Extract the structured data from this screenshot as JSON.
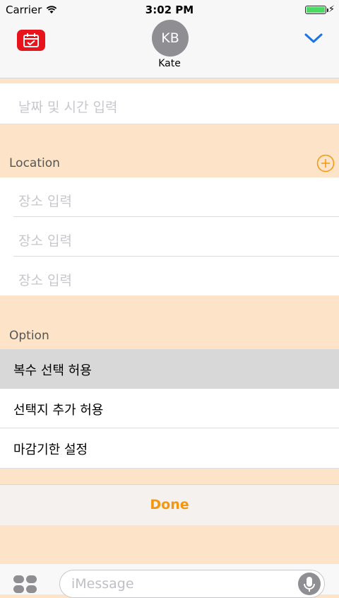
{
  "status_bar": {
    "carrier": "Carrier",
    "time": "3:02 PM",
    "wifi_icon": "wifi-icon",
    "battery_icon": "battery-icon"
  },
  "header": {
    "app_icon": "calendar-check-icon",
    "avatar_initials": "KB",
    "contact_name": "Kate",
    "collapse_icon": "chevron-down-icon",
    "accent_color": "#1a73e8"
  },
  "datetime": {
    "placeholder": "날짜 및 시간 입력"
  },
  "location": {
    "label": "Location",
    "add_icon": "plus-circle-icon",
    "placeholders": [
      "장소 입력",
      "장소 입력",
      "장소 입력"
    ]
  },
  "option": {
    "label": "Option",
    "items": [
      {
        "label": "복수 선택 허용",
        "selected": true
      },
      {
        "label": "선택지 추가 허용",
        "selected": false
      },
      {
        "label": "마감기한 설정",
        "selected": false
      }
    ]
  },
  "done": {
    "label": "Done",
    "color": "#f5960c"
  },
  "message_bar": {
    "placeholder": "iMessage",
    "apps_icon": "apps-icon",
    "mic_icon": "microphone-icon"
  },
  "colors": {
    "background": "#fde4c8",
    "app_icon": "#e8141c",
    "accent": "#f5960c"
  }
}
